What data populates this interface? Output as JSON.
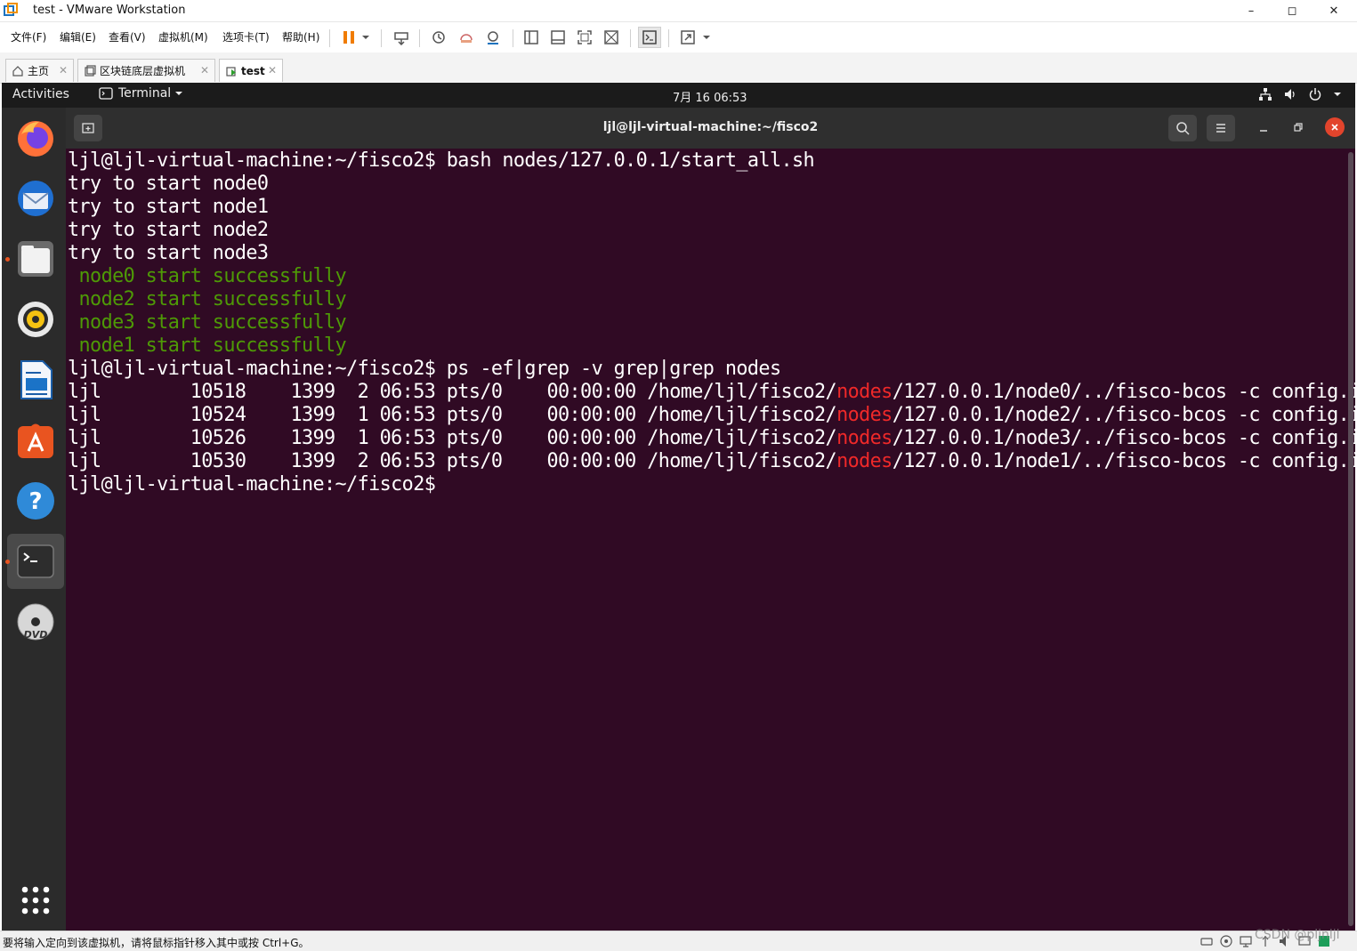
{
  "window": {
    "title": "test - VMware Workstation",
    "minimize": "–",
    "maximize": "◻",
    "close": "✕"
  },
  "menu": [
    "文件(F)",
    "编辑(E)",
    "查看(V)",
    "虚拟机(M)",
    "选项卡(T)",
    "帮助(H)"
  ],
  "tabs": [
    {
      "label": "主页",
      "icon": "home-icon",
      "active": false
    },
    {
      "label": "区块链底层虚拟机",
      "icon": "vm-icon",
      "active": false
    },
    {
      "label": "test",
      "icon": "vm-running-icon",
      "active": true
    }
  ],
  "tab_close": "✕",
  "ubuntu_topbar": {
    "activities": "Activities",
    "app_menu": "Terminal",
    "clock": "7月 16  06:53"
  },
  "terminal": {
    "title": "ljl@ljl-virtual-machine:~/fisco2",
    "lines": [
      "ljl@ljl-virtual-machine:~/fisco2$ bash nodes/127.0.0.1/start_all.sh",
      "try to start node0",
      "try to start node1",
      "try to start node2",
      "try to start node3",
      " node0 start successfully",
      " node2 start successfully",
      " node3 start successfully",
      " node1 start successfully",
      "ljl@ljl-virtual-machine:~/fisco2$ ps -ef|grep -v grep|grep nodes",
      "ljl        10518    1399  2 06:53 pts/0    00:00:00 /home/ljl/fisco2/nodes/127.0.0.1/node0/../fisco-bcos -c config.ini",
      "ljl        10524    1399  1 06:53 pts/0    00:00:00 /home/ljl/fisco2/nodes/127.0.0.1/node2/../fisco-bcos -c config.ini",
      "ljl        10526    1399  1 06:53 pts/0    00:00:00 /home/ljl/fisco2/nodes/127.0.0.1/node3/../fisco-bcos -c config.ini",
      "ljl        10530    1399  2 06:53 pts/0    00:00:00 /home/ljl/fisco2/nodes/127.0.0.1/node1/../fisco-bcos -c config.ini",
      "ljl@ljl-virtual-machine:~/fisco2$ "
    ],
    "highlight_word": "nodes",
    "colors": {
      "background": "#300a24",
      "text": "#ffffff",
      "success": "#4e9a06",
      "highlight": "#ef2929"
    }
  },
  "dock": [
    {
      "name": "firefox-icon",
      "running": false
    },
    {
      "name": "thunderbird-icon",
      "running": false
    },
    {
      "name": "files-icon",
      "running": true
    },
    {
      "name": "rhythmbox-icon",
      "running": false
    },
    {
      "name": "writer-icon",
      "running": false
    },
    {
      "name": "app-center-icon",
      "running": false
    },
    {
      "name": "help-icon",
      "running": false
    },
    {
      "name": "terminal-icon",
      "running": true
    },
    {
      "name": "dvd-icon",
      "running": false
    }
  ],
  "status": {
    "message": "要将输入定向到该虚拟机，请将鼠标指针移入其中或按 Ctrl+G。",
    "watermark": "CSDN @pljnljl"
  }
}
